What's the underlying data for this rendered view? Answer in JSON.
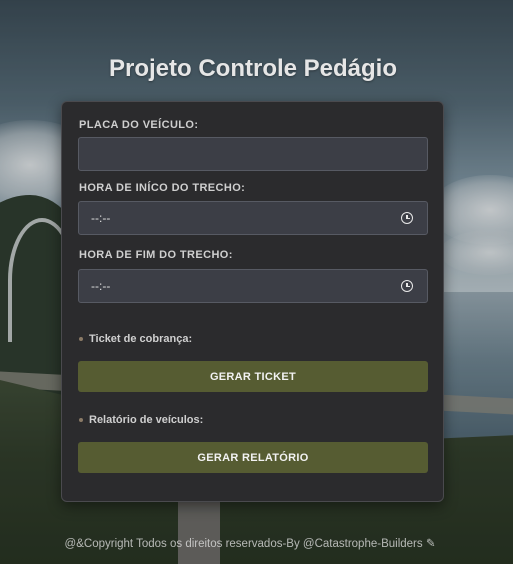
{
  "page": {
    "title": "Projeto Controle Pedágio",
    "footer": "@&Copyright Todos os direitos reservados-By @Catastrophe-Builders ✎"
  },
  "form": {
    "plate": {
      "label": "PLACA DO VEÍCULO:",
      "value": ""
    },
    "start_time": {
      "label": "HORA DE INÍCO DO TRECHO:",
      "value": "--:--",
      "icon": "clock-icon"
    },
    "end_time": {
      "label": "HORA DE FIM DO TRECHO:",
      "value": "--:--",
      "icon": "clock-icon"
    },
    "ticket_section": {
      "label": "Ticket de cobrança:",
      "button": "GERAR TICKET"
    },
    "report_section": {
      "label": "Relatório de veículos:",
      "button": "GERAR RELATÓRIO"
    }
  },
  "colors": {
    "card_background": "#2b2b2d",
    "input_background": "#3c3e46",
    "button_background": "#565c32",
    "title_text": "#e6e6e6"
  }
}
